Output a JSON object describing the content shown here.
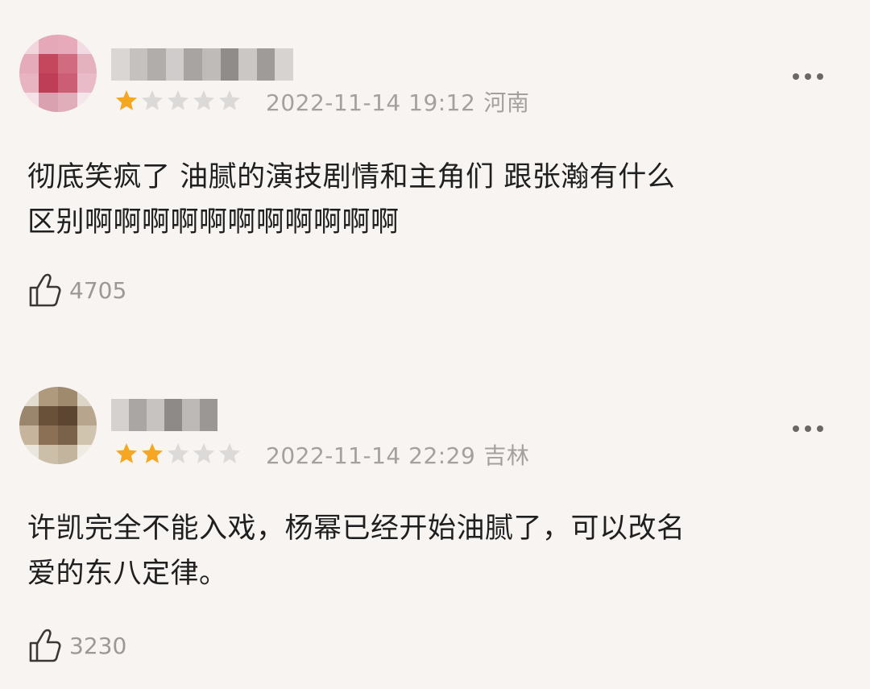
{
  "comments": [
    {
      "rating": 1,
      "max_rating": 5,
      "date": "2022-11-14 19:12",
      "region": "河南",
      "text": "彻底笑疯了 油腻的演技剧情和主角们 跟张瀚有什么\n区别啊啊啊啊啊啊啊啊啊啊啊",
      "likes": "4705",
      "avatar_colors": [
        "#f2d6dd",
        "#e6a7b8",
        "#e8a9bb",
        "#f3dbe2",
        "#e8aabb",
        "#c9465e",
        "#d46a80",
        "#e6b0bf",
        "#eab3c2",
        "#c23c56",
        "#cf5d75",
        "#ebbac8",
        "#f5e2e8",
        "#dca0b1",
        "#e2adbb",
        "#f6e6eb"
      ],
      "name_blur_colors": [
        "#d9d6d4",
        "#c4c1bf",
        "#b0adab",
        "#cfcccb",
        "#a7a4a2",
        "#bebbb9",
        "#8f8c8a",
        "#cac7c5",
        "#9e9b99",
        "#d6d3d1"
      ]
    },
    {
      "rating": 2,
      "max_rating": 5,
      "date": "2022-11-14 22:29",
      "region": "吉林",
      "text": "许凯完全不能入戏，杨幂已经开始油腻了，可以改名\n爱的东八定律。",
      "likes": "3230",
      "avatar_colors": [
        "#e3dccf",
        "#b09a7c",
        "#a18a6c",
        "#ddd5c6",
        "#9b866c",
        "#6a5138",
        "#5e4630",
        "#b8a58c",
        "#c7b59b",
        "#8c7054",
        "#7b6249",
        "#d2c4ae",
        "#ebe6dc",
        "#cdbfa8",
        "#c3b49c",
        "#efebe3"
      ],
      "name_blur_colors": [
        "#d4d1cf",
        "#a9a6a4",
        "#c6c3c1",
        "#8d8a88",
        "#bcb9b7",
        "#9a9795"
      ]
    }
  ],
  "colors": {
    "star_active": "#f5a623",
    "star_inactive": "#dcdad8",
    "meta_text": "#a3a09d",
    "background": "#f7f4f2"
  },
  "icons": {
    "like": "thumb-up-icon",
    "more": "more-dots-icon"
  }
}
